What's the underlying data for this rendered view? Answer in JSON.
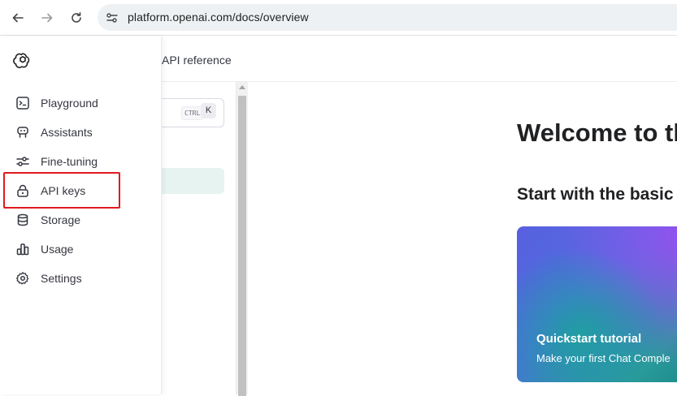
{
  "browser": {
    "url": "platform.openai.com/docs/overview",
    "back_icon": "back-arrow-icon",
    "forward_icon": "forward-arrow-icon",
    "reload_icon": "reload-icon",
    "site_info_icon": "tune-icon"
  },
  "docs": {
    "header_link": "API reference",
    "search_shortcut_ctrl": "CTRL",
    "search_shortcut_key": "K",
    "welcome_title": "Welcome to th",
    "start_heading": "Start with the basic",
    "card": {
      "title": "Quickstart tutorial",
      "description": "Make your first Chat Comple"
    }
  },
  "sidebar": {
    "logo_icon": "openai-logo-icon",
    "items": [
      {
        "label": "Playground",
        "icon": "terminal-icon"
      },
      {
        "label": "Assistants",
        "icon": "robot-icon"
      },
      {
        "label": "Fine-tuning",
        "icon": "sliders-icon"
      },
      {
        "label": "API keys",
        "icon": "lock-icon"
      },
      {
        "label": "Storage",
        "icon": "database-icon"
      },
      {
        "label": "Usage",
        "icon": "bar-chart-icon"
      },
      {
        "label": "Settings",
        "icon": "gear-icon"
      }
    ]
  },
  "highlight_color": "#e0191f"
}
